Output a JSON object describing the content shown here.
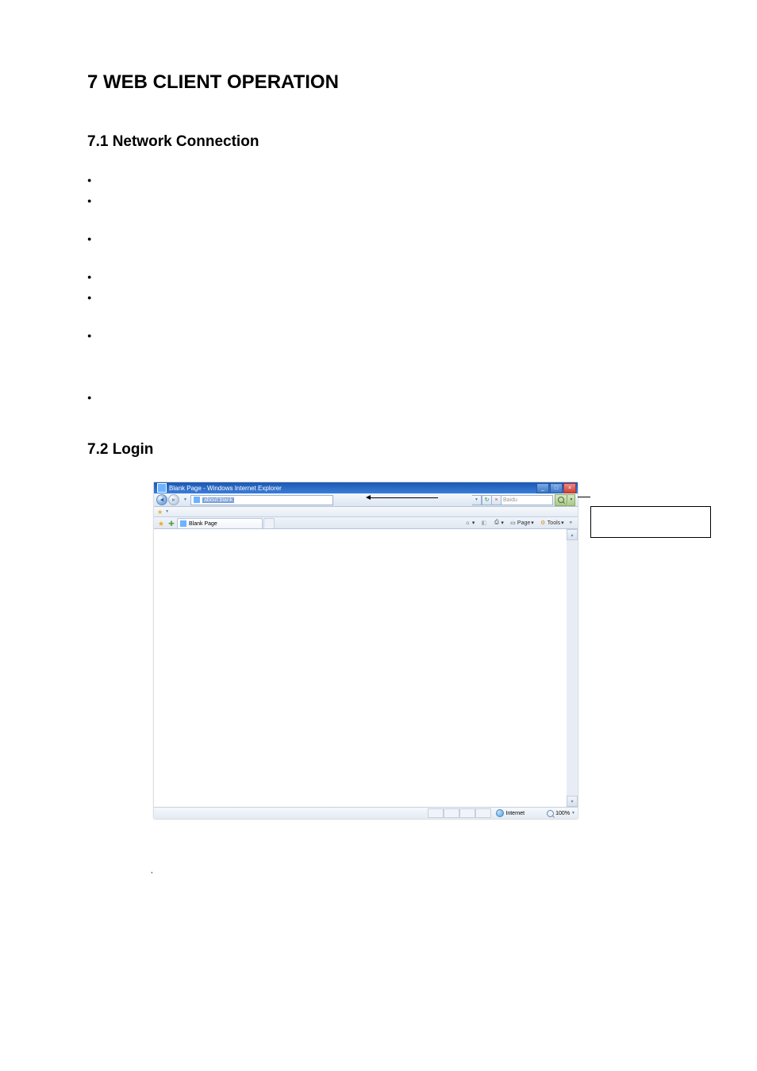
{
  "headings": {
    "h1": "7  WEB CLIENT OPERATION",
    "h2_1": "7.1  Network Connection",
    "h2_2": "7.2  Login"
  },
  "browser": {
    "title": "Blank Page - Windows Internet Explorer",
    "address": "about:blank",
    "search_placeholder": "Baidu",
    "tab_label": "Blank Page",
    "cmd": {
      "page": "Page",
      "tools": "Tools"
    },
    "zone": "Internet",
    "zoom": "100%"
  },
  "icons": {
    "links_icon": "⛓",
    "home": "🏠",
    "feed": "▦",
    "print": "⎙",
    "page": "▭",
    "tools": "⚙"
  }
}
